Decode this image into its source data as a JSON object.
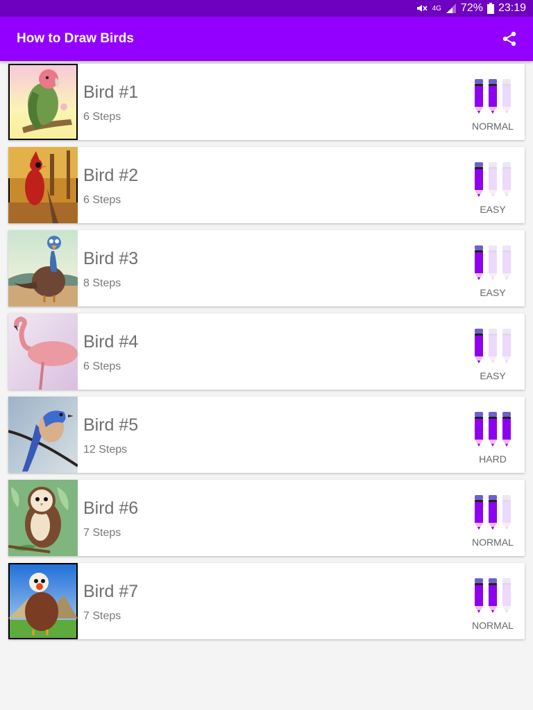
{
  "status_bar": {
    "network": "4G",
    "battery": "72%",
    "time": "23:19"
  },
  "app_bar": {
    "title": "How to Draw Birds",
    "share_icon": "share-icon"
  },
  "colors": {
    "status_bar": "#6e00bf",
    "app_bar": "#9300ff",
    "pencil_active": "#8e00f0",
    "pencil_inactive": "#ecd9fb"
  },
  "birds": [
    {
      "name": "Bird #1",
      "steps": "6 Steps",
      "difficulty": "NORMAL",
      "level": 2
    },
    {
      "name": "Bird #2",
      "steps": "6 Steps",
      "difficulty": "EASY",
      "level": 1
    },
    {
      "name": "Bird #3",
      "steps": "8 Steps",
      "difficulty": "EASY",
      "level": 1
    },
    {
      "name": "Bird #4",
      "steps": "6 Steps",
      "difficulty": "EASY",
      "level": 1
    },
    {
      "name": "Bird #5",
      "steps": "12 Steps",
      "difficulty": "HARD",
      "level": 3
    },
    {
      "name": "Bird #6",
      "steps": "7 Steps",
      "difficulty": "NORMAL",
      "level": 2
    },
    {
      "name": "Bird #7",
      "steps": "7 Steps",
      "difficulty": "NORMAL",
      "level": 2
    }
  ]
}
